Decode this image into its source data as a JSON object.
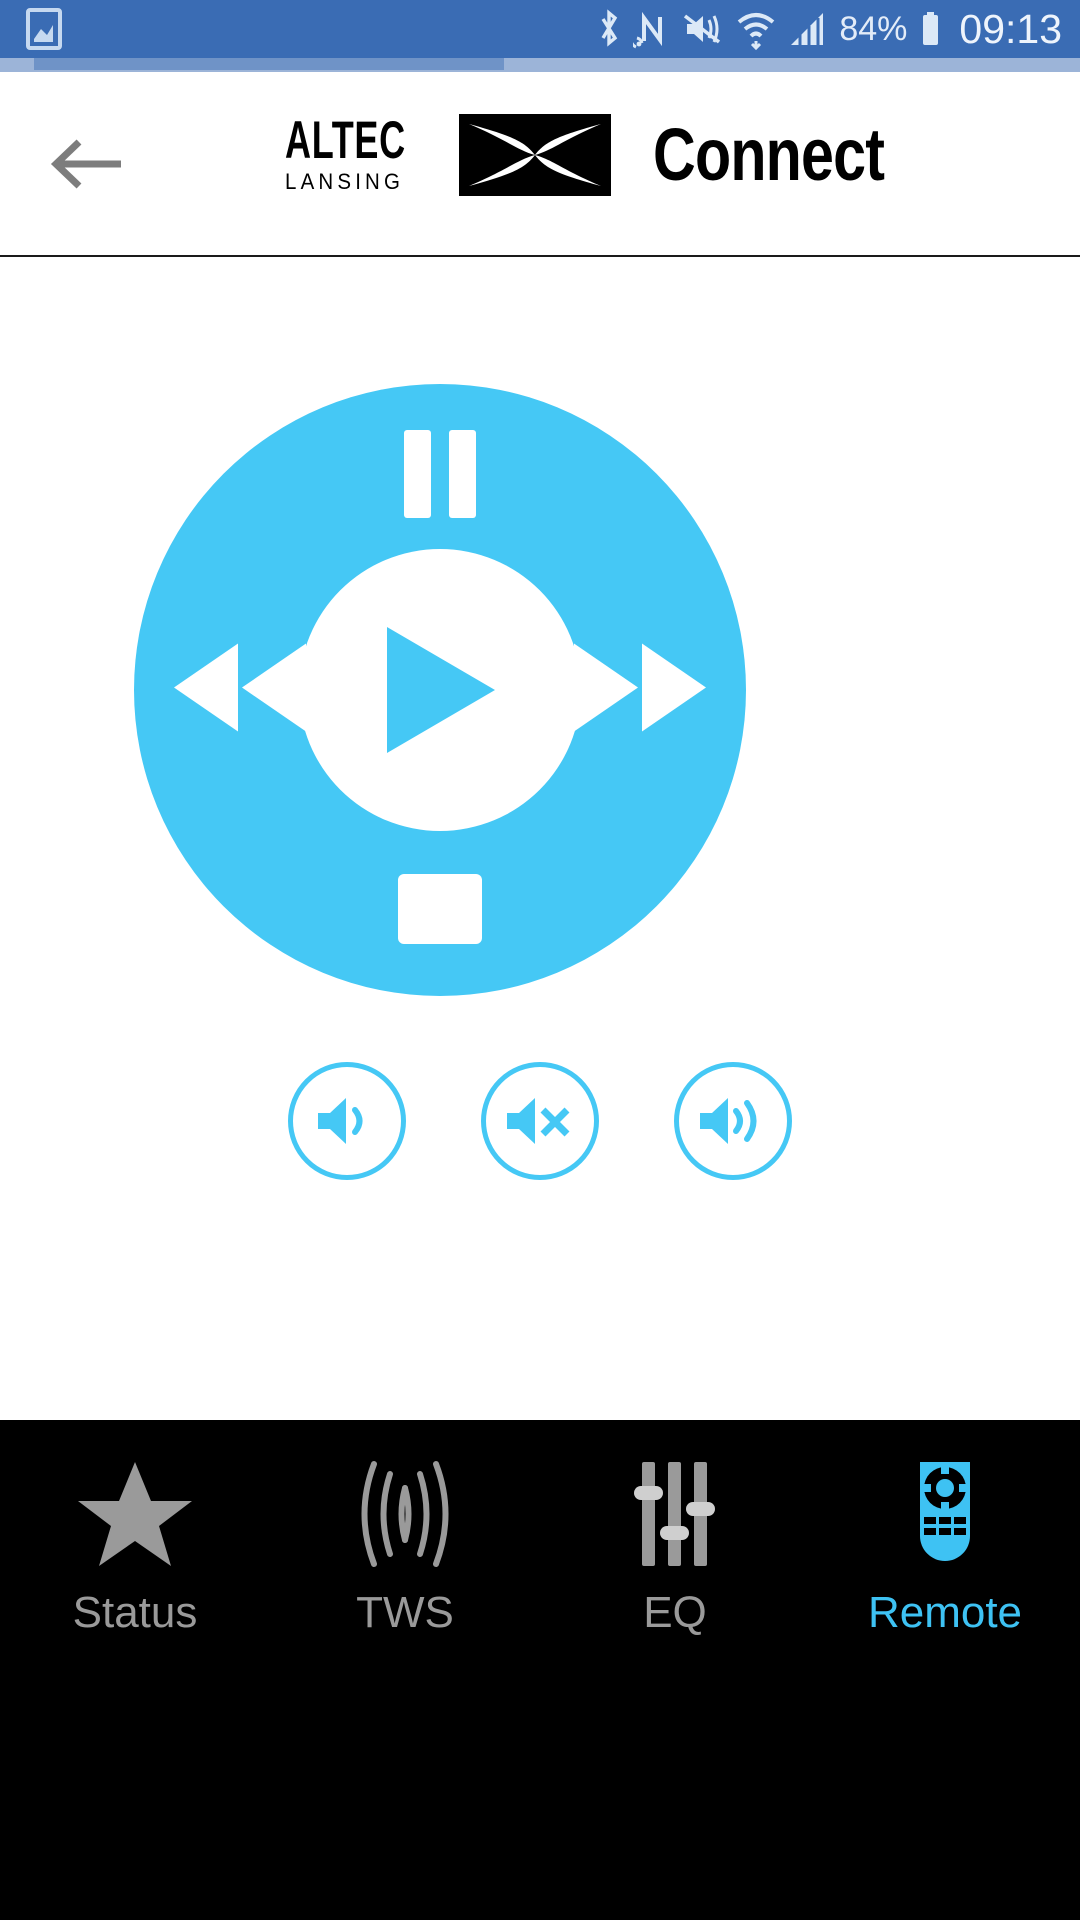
{
  "status_bar": {
    "background_color": "#3a6cb4",
    "time": "09:13",
    "battery_percent": "84%",
    "icons": [
      {
        "name": "screenshot-gallery-icon",
        "position": "left"
      },
      {
        "name": "bluetooth-icon",
        "position": "right"
      },
      {
        "name": "nfc-icon",
        "position": "right"
      },
      {
        "name": "sound-off-vibrate-icon",
        "position": "right"
      },
      {
        "name": "wifi-icon",
        "position": "right"
      },
      {
        "name": "cellular-signal-icon",
        "position": "right"
      },
      {
        "name": "battery-icon",
        "position": "right"
      }
    ]
  },
  "header": {
    "back_label": "Back",
    "brand_primary": "ALTEC",
    "brand_secondary": "LANSING",
    "title": "Connect",
    "title_color": "#000000"
  },
  "remote_control": {
    "dial_color": "#45c8f5",
    "accent_color": "#45c8f5",
    "buttons": {
      "pause_label": "Pause",
      "play_label": "Play",
      "stop_label": "Stop",
      "previous_label": "Previous",
      "next_label": "Next"
    },
    "volume_buttons": [
      {
        "name": "volume-down-button",
        "label": "Volume Down",
        "icon": "speaker-low-icon"
      },
      {
        "name": "mute-button",
        "label": "Mute",
        "icon": "speaker-mute-icon"
      },
      {
        "name": "volume-up-button",
        "label": "Volume Up",
        "icon": "speaker-high-icon"
      }
    ]
  },
  "bottom_nav": {
    "background_color": "#000000",
    "inactive_color": "#9a9a9a",
    "active_color": "#3ec2f3",
    "items": [
      {
        "label": "Status",
        "icon": "star-icon",
        "active": false
      },
      {
        "label": "TWS",
        "icon": "broadcast-waves-icon",
        "active": false
      },
      {
        "label": "EQ",
        "icon": "equalizer-sliders-icon",
        "active": false
      },
      {
        "label": "Remote",
        "icon": "remote-control-icon",
        "active": true
      }
    ]
  }
}
